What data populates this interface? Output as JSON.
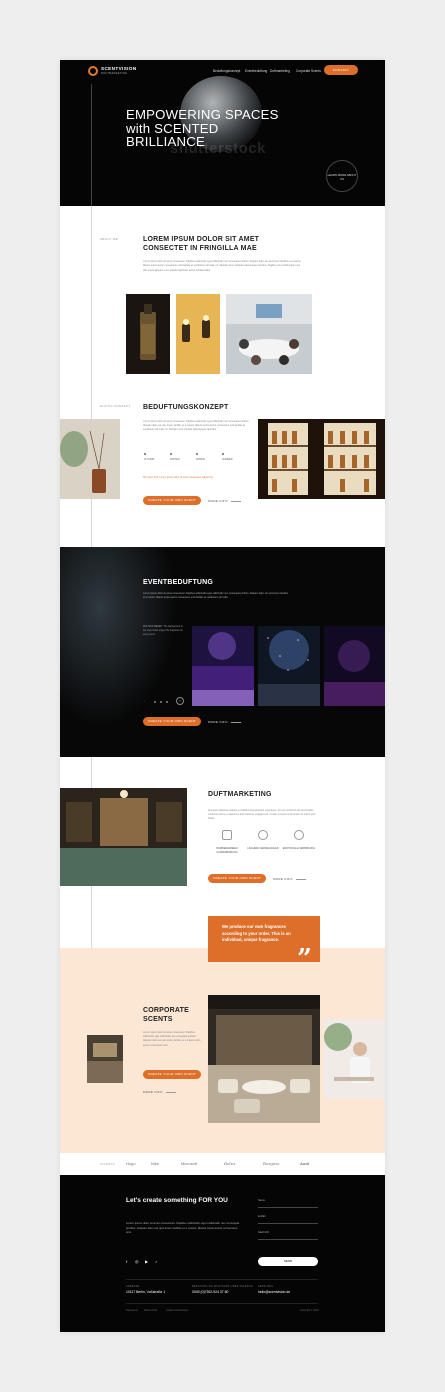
{
  "header": {
    "brand": "SCENTVISION",
    "brand_sub": "DUFTMARKETING",
    "nav": [
      "Beduftungskonzept",
      "Eventbeduftung",
      "Duftmarketing",
      "Corporate Scents"
    ],
    "cta": "KONTAKT"
  },
  "hero": {
    "title": "EMPOWERING SPACES with SCENTED BRILLIANCE",
    "watermark": "shutterstock",
    "circle_link": "LEARN MORE ABOUT US"
  },
  "intro": {
    "label": "ABOUT ME",
    "title": "LOREM IPSUM DOLOR SIT AMET CONSECTET IN FRINGILLA MAE",
    "body": "Lorem ipsum dolor sit amet consectetur. Dapibus sollicitudin eget sollicitudin nec consequat porttitor. Aliquam diam est quis lorem facilisis et a mauris. Mauris turpis auctor consectetur erat facilisis at vestibulum elit nulla. Ut. Sitetiam risus volutpat pellentesque faucibus. Sagittis erat condimentum nec duis morbi aliquam nunc gravida dignissim auctor volutpat diam."
  },
  "concept": {
    "label": "DUFTIG KONZEPT",
    "title": "BEDUFTUNGSKONZEPT",
    "body": "Lorem ipsum dolor sit amet consectetur. Dapibus sollicitudin eget sollicitudin nec consequat porttitor. Aliquam diam est quis lorem facilisis et a mauris. Mauris turpis auctor consectetur erat facilisis at vestibulum elit nulla. Ut. Sitetiam risus volutpat pellentesque faucibus.",
    "seasons": [
      "AUTUMN",
      "WINTER",
      "SPRING",
      "SUMMER"
    ],
    "note": "Wir leben Duft. Lorem ipsum dolor sit amet consectetur adipiscing.",
    "cta": "CREATE YOUR OWN SCENT",
    "more": "MORE INFO"
  },
  "event": {
    "title": "EVENTBEDUFTUNG",
    "body": "Lorem ipsum dolor sit amet consectetur. Dapibus sollicitudin eget sollicitudin nec consequat porttitor. Aliquam diam est quis lorem facilisis et a mauris. Mauris turpis auctor consectetur erat facilisis at vestibulum elit nulla.",
    "side_text": "WIR SIND BEREIT. The background of our scent team enjoys the fragrance for every event.",
    "cta": "CREATE YOUR OWN SCENT",
    "more": "MORE INFO"
  },
  "marketing": {
    "title": "DUFTMARKETING",
    "body": "Scented marketing enables a multidimensional brand experience. For an emotional and memorable customer journey, experience and customer engagement. Create a unique environment to match your brand.",
    "features": [
      "BARRIEREFREIEN KUNDENBINDUNG",
      "LÄNGERE VERWEILDAUER",
      "EMOTIONALE VERBINDUNG"
    ],
    "cta": "CREATE YOUR OWN SCENT",
    "more": "MORE INFO"
  },
  "quote": {
    "text": "We produce our own fragrances according to your order. This is an individual, unique fragrance."
  },
  "corporate": {
    "title": "CORPORATE SCENTS",
    "body": "Lorem ipsum dolor sit amet consectetur. Dapibus sollicitudin eget sollicitudin nec consequat porttitor. Aliquam diam est quis lorem facilisis et a mauris turpis auctor consectetur erat.",
    "cta": "CREATE YOUR OWN SCENT",
    "more": "MORE INFO"
  },
  "logos": {
    "label": "CLIENTS",
    "items": [
      "Hugo",
      "Nike",
      "Microsoft",
      "Rolex",
      "Burgess",
      "Audi"
    ]
  },
  "footer": {
    "title": "Let's create something FOR YOU",
    "body": "Lorem ipsum dolor sit amet consectetur. Dapibus sollicitudin eget sollicitudin nec consequat porttitor. Aliquam diam est quis lorem facilisis et a mauris. Mauris turpis auctor consectetur erat.",
    "fields": [
      "Name",
      "E-Mail",
      "Nachricht"
    ],
    "send": "SEND",
    "social": [
      "f",
      "◎",
      "▶",
      "♪"
    ],
    "address_label": "ADRESSE",
    "address": "10117 Berlin, Voßstraße 1",
    "phone_label": "BERATUNG VIA WHATSAPP ODER TELEFON",
    "phone": "0049 (0)7262-924 37 80",
    "email_label": "SEND MAIL",
    "email": "hello@scentvision.de",
    "bottom_links": [
      "Impressum",
      "Datenschutz",
      "Cookie-Einstellungen"
    ],
    "copyright": "Copyright © 2024"
  }
}
